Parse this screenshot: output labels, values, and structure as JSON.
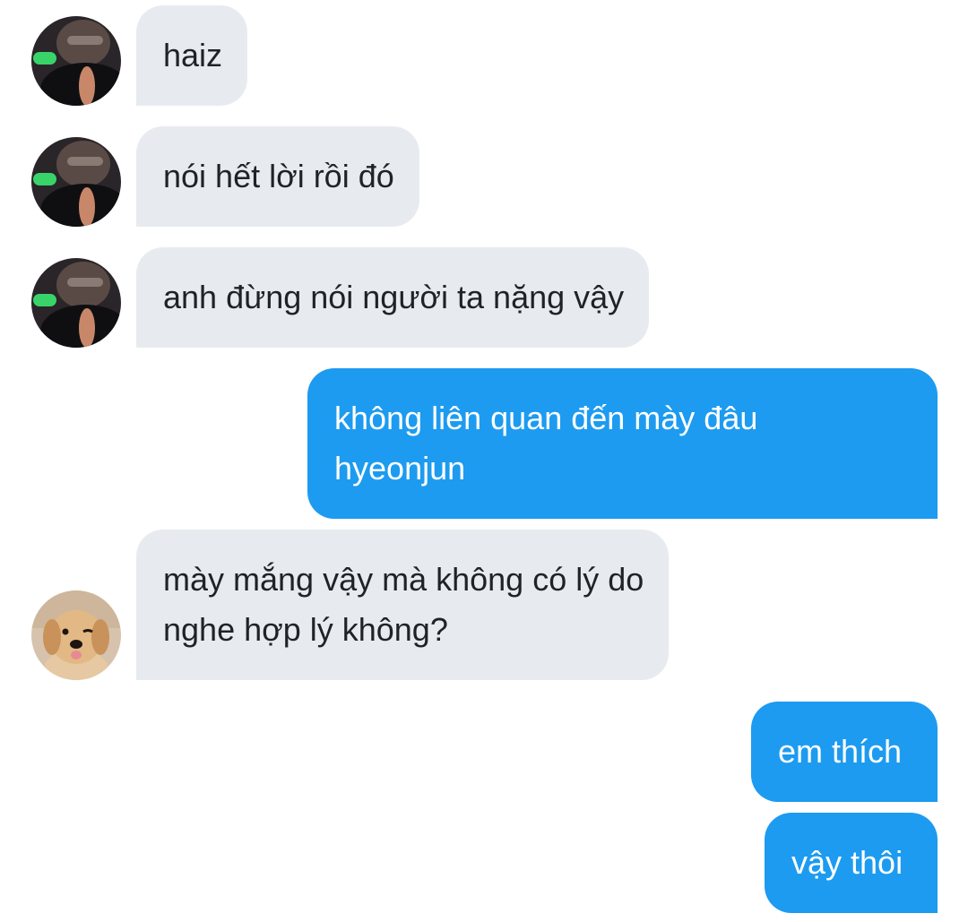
{
  "colors": {
    "incoming_bubble": "#e7ebf0",
    "outgoing_bubble": "#1d9bf0",
    "incoming_text": "#1f2328",
    "outgoing_text": "#ffffff"
  },
  "messages": [
    {
      "direction": "incoming",
      "avatar": "person-avatar",
      "lines": [
        "haiz"
      ]
    },
    {
      "direction": "incoming",
      "avatar": "person-avatar",
      "lines": [
        "nói hết lời rồi đó"
      ]
    },
    {
      "direction": "incoming",
      "avatar": "person-avatar",
      "lines": [
        "anh đừng nói người ta nặng vậy"
      ]
    },
    {
      "direction": "outgoing",
      "lines": [
        "không liên quan đến mày đâu",
        "hyeonjun"
      ]
    },
    {
      "direction": "incoming",
      "avatar": "dog-avatar",
      "lines": [
        "mày mắng vậy mà không có lý do",
        "nghe hợp lý không?"
      ]
    },
    {
      "direction": "outgoing",
      "lines": [
        "em thích"
      ]
    },
    {
      "direction": "outgoing",
      "lines": [
        "vậy thôi"
      ]
    }
  ]
}
